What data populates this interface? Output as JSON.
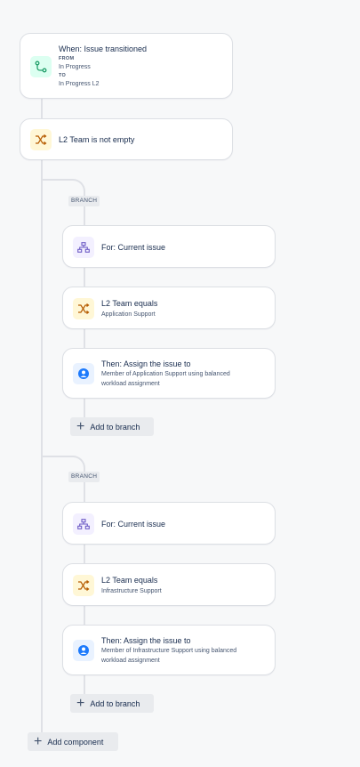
{
  "trigger": {
    "title": "When: Issue transitioned",
    "from_label": "FROM",
    "from_value": "In Progress",
    "to_label": "TO",
    "to_value": "In Progress L2",
    "icon": "transition-icon",
    "icon_color": "#22a06b"
  },
  "condition": {
    "title": "L2 Team is not empty",
    "icon": "shuffle-icon",
    "icon_color": "#b65c02"
  },
  "branches": [
    {
      "tag": "BRANCH",
      "for_title": "For: Current issue",
      "cond_title": "L2 Team equals",
      "cond_value": "Application Support",
      "action_title": "Then: Assign the issue to",
      "action_line1": "Member of Application Support using balanced",
      "action_line2": "workload assignment",
      "add_label": "Add to branch"
    },
    {
      "tag": "BRANCH",
      "for_title": "For: Current issue",
      "cond_title": "L2 Team equals",
      "cond_value": "Infrastructure Support",
      "action_title": "Then: Assign the issue to",
      "action_line1": "Member of Infrastructure Support using balanced",
      "action_line2": "workload assignment",
      "add_label": "Add to branch"
    }
  ],
  "add_component_label": "Add component",
  "colors": {
    "connector": "#dfe1e6",
    "purple_icon": "#6e5dc6",
    "blue_icon": "#1d7afc"
  }
}
